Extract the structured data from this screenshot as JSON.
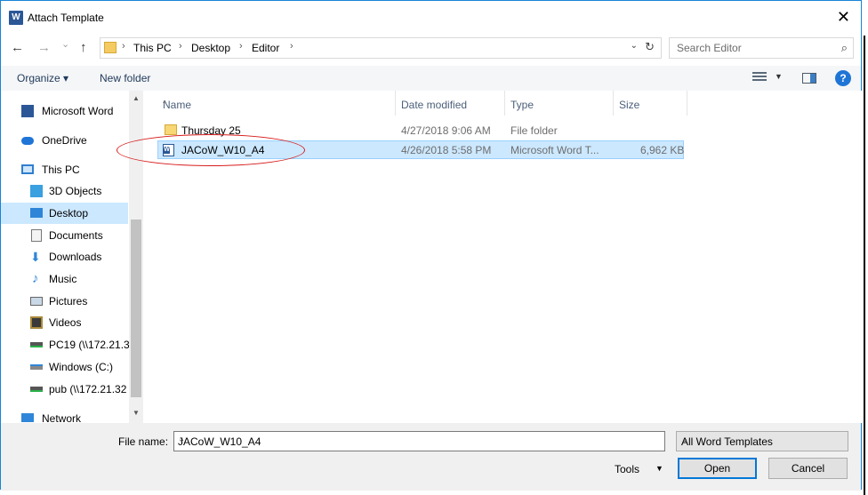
{
  "window": {
    "title": "Attach Template",
    "title_icon": "W",
    "close_glyph": "✕"
  },
  "nav_buttons": {
    "back": "←",
    "forward": "→",
    "recent": "⌄",
    "up": "↑"
  },
  "address": {
    "crumbs": [
      "This PC",
      "Desktop",
      "Editor"
    ],
    "separator": "›",
    "dropdown_glyph": "⌄",
    "refresh_glyph": "↻"
  },
  "search": {
    "placeholder": "Search Editor",
    "icon_glyph": "⌕"
  },
  "toolbar": {
    "organize": "Organize ▾",
    "new_folder": "New folder",
    "view_dropdown": "▼",
    "help": "?"
  },
  "nav_pane": {
    "items": [
      {
        "label": "Microsoft Word",
        "icon": "word-icon"
      },
      {
        "label": "OneDrive",
        "icon": "cloud-icon"
      },
      {
        "label": "This PC",
        "icon": "computer-icon"
      },
      {
        "label": "3D Objects",
        "icon": "cube-icon"
      },
      {
        "label": "Desktop",
        "icon": "desktop-icon",
        "selected": true
      },
      {
        "label": "Documents",
        "icon": "document-icon"
      },
      {
        "label": "Downloads",
        "icon": "download-icon"
      },
      {
        "label": "Music",
        "icon": "music-icon"
      },
      {
        "label": "Pictures",
        "icon": "picture-icon"
      },
      {
        "label": "Videos",
        "icon": "video-icon"
      },
      {
        "label": "PC19 (\\\\172.21.3",
        "icon": "network-drive-icon"
      },
      {
        "label": "Windows (C:)",
        "icon": "drive-icon"
      },
      {
        "label": "pub (\\\\172.21.32",
        "icon": "network-drive-icon"
      },
      {
        "label": "Network",
        "icon": "network-icon"
      }
    ],
    "scroll_up": "▲",
    "scroll_down": "▼"
  },
  "columns": {
    "name": "Name",
    "date": "Date modified",
    "type": "Type",
    "size": "Size",
    "sort_glyph": "^"
  },
  "files": [
    {
      "name": "Thursday 25",
      "date": "4/27/2018 9:06 AM",
      "type": "File folder",
      "size": "",
      "icon": "folder-icon"
    },
    {
      "name": "JACoW_W10_A4",
      "date": "4/26/2018 5:58 PM",
      "type": "Microsoft Word T...",
      "size": "6,962 KB",
      "icon": "word-template-icon",
      "selected": true
    }
  ],
  "bottom": {
    "file_name_label": "File name:",
    "file_name_value": "JACoW_W10_A4",
    "file_type": "All Word Templates",
    "dropdown_glyph": "⌄",
    "tools": "Tools",
    "tools_dd": "▼",
    "open": "Open",
    "cancel": "Cancel"
  }
}
